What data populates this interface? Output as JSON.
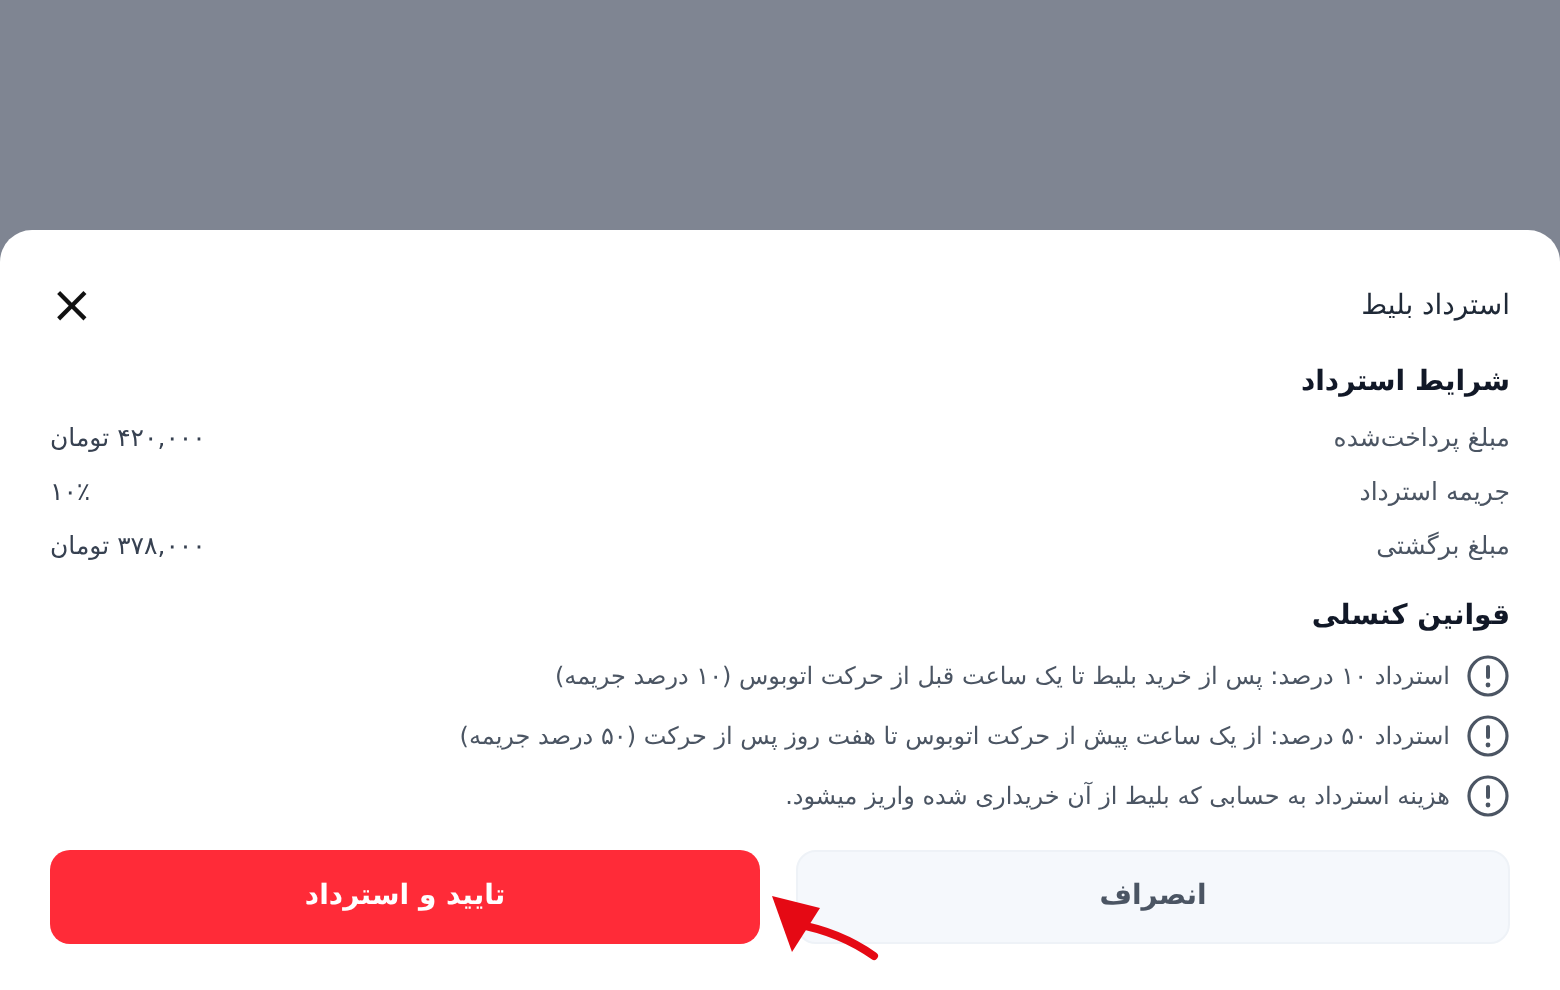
{
  "sheet": {
    "title": "استرداد بلیط",
    "close": "×"
  },
  "conditions": {
    "heading": "شرایط استرداد",
    "rows": [
      {
        "label": "مبلغ پرداخت‌شده",
        "value": "۴۲۰,۰۰۰ تومان"
      },
      {
        "label": "جریمه استرداد",
        "value": "۱۰٪"
      },
      {
        "label": "مبلغ برگشتی",
        "value": "۳۷۸,۰۰۰ تومان"
      }
    ]
  },
  "rules": {
    "heading": "قوانین کنسلی",
    "items": [
      "استرداد ۱۰ درصد: پس از خرید بلیط تا یک ساعت قبل از حرکت اتوبوس (۱۰ درصد جریمه)",
      "استرداد ۵۰ درصد: از یک ساعت پیش از حرکت اتوبوس تا هفت روز پس از حرکت (۵۰ درصد جریمه)",
      "هزینه استرداد به حسابی که بلیط از آن خریداری شده واریز میشود."
    ]
  },
  "buttons": [
    {
      "label": "انصراف",
      "kind": "secondary"
    },
    {
      "label": "تایید و استرداد",
      "kind": "primary"
    }
  ]
}
